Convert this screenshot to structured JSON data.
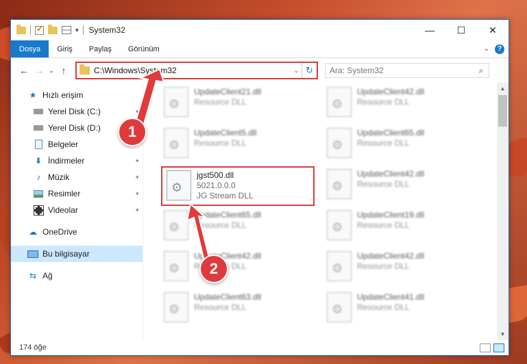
{
  "window": {
    "title": "System32",
    "minimize": "—",
    "maximize": "☐",
    "close": "✕"
  },
  "ribbon": {
    "tabs": [
      "Dosya",
      "Giriş",
      "Paylaş",
      "Görünüm"
    ],
    "collapse": "⌄",
    "help": "?"
  },
  "nav": {
    "back": "←",
    "forward": "→",
    "recent": "⌄",
    "up": "↑"
  },
  "address": {
    "path": "C:\\Windows\\System32",
    "dropdown": "⌄",
    "refresh": "↻"
  },
  "search": {
    "placeholder": "Ara: System32",
    "icon": "search-icon"
  },
  "sidebar": {
    "items": [
      {
        "label": "Hızlı erişim",
        "icon": "star-icon",
        "glyph": "★"
      },
      {
        "label": "Yerel Disk (C:)",
        "icon": "disk-icon",
        "pin": "📌"
      },
      {
        "label": "Yerel Disk (D:)",
        "icon": "disk-icon"
      },
      {
        "label": "Belgeler",
        "icon": "document-icon"
      },
      {
        "label": "İndirmeler",
        "icon": "download-icon",
        "glyph": "⬇",
        "pin": "📌"
      },
      {
        "label": "Müzik",
        "icon": "music-icon",
        "glyph": "♪",
        "pin": "📌"
      },
      {
        "label": "Resimler",
        "icon": "pictures-icon",
        "pin": "📌"
      },
      {
        "label": "Videolar",
        "icon": "video-icon",
        "pin": "📌"
      },
      {
        "label": "OneDrive",
        "icon": "cloud-icon",
        "glyph": "☁"
      },
      {
        "label": "Bu bilgisayar",
        "icon": "computer-icon"
      },
      {
        "label": "Ağ",
        "icon": "network-icon",
        "glyph": "⇆"
      }
    ]
  },
  "files": [
    {
      "name": "UpdateClient21.dll",
      "desc": "Resource DLL"
    },
    {
      "name": "UpdateClient42.dll",
      "desc": "Resource DLL"
    },
    {
      "name": "UpdateClient5.dll",
      "desc": "Resource DLL"
    },
    {
      "name": "UpdateClient65.dll",
      "desc": "Resource DLL"
    },
    {
      "name": "jgst500.dll",
      "version": "5021.0.0.0",
      "desc": "JG Stream DLL"
    },
    {
      "name": "UpdateClient42.dll",
      "desc": "Resource DLL"
    },
    {
      "name": "UpdateClient65.dll",
      "desc": "Resource DLL"
    },
    {
      "name": "UpdateClient19.dll",
      "desc": "Resource DLL"
    },
    {
      "name": "UpdateClient42.dll",
      "desc": "Resource DLL"
    },
    {
      "name": "UpdateClient42.dll",
      "desc": "Resource DLL"
    },
    {
      "name": "UpdateClient63.dll",
      "desc": "Resource DLL"
    },
    {
      "name": "UpdateClient41.dll",
      "desc": "Resource DLL"
    }
  ],
  "status": {
    "count": "174 öğe"
  },
  "callouts": [
    "1",
    "2"
  ],
  "colors": {
    "accent": "#1979ca",
    "highlight_red": "#d93b3b",
    "callout_red": "#e03a3a"
  }
}
